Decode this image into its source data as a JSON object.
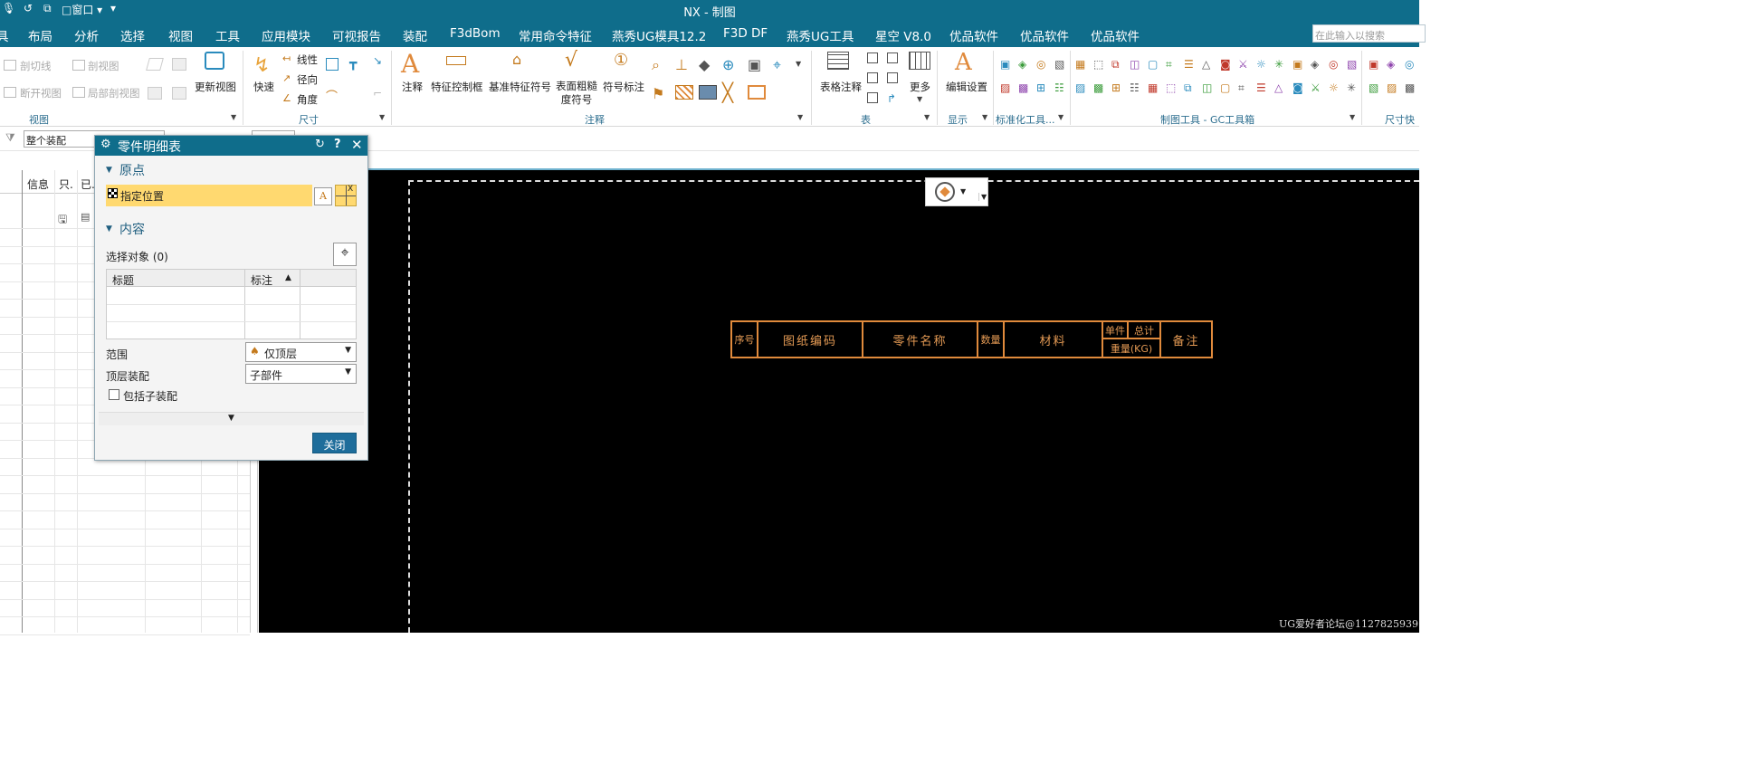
{
  "window": {
    "title": "NX - 制图",
    "window_menu": "窗口"
  },
  "menu": [
    "具",
    "布局",
    "分析",
    "选择",
    "视图",
    "工具",
    "应用模块",
    "可视报告",
    "装配",
    "F3dBom",
    "常用命令特征",
    "燕秀UG模具12.2",
    "F3D DF",
    "燕秀UG工具",
    "星空 V8.0",
    "优品软件",
    "优品软件",
    "优品软件"
  ],
  "search": {
    "placeholder": "在此输入以搜索"
  },
  "ribbon": {
    "view_group": {
      "label": "视图",
      "items": [
        "剖切线",
        "剖视图",
        "断开视图",
        "局部剖视图",
        "更新视图"
      ]
    },
    "dim_group": {
      "label": "尺寸",
      "items": [
        "快速",
        "线性",
        "径向",
        "角度"
      ]
    },
    "annotation_group": {
      "label": "注释",
      "items": [
        "注释",
        "特征控制框",
        "基准特征符号",
        "表面粗糙度符号",
        "符号标注"
      ]
    },
    "table_group": {
      "label": "表",
      "items": [
        "表格注释",
        "更多"
      ]
    },
    "display_group": {
      "label": "显示",
      "items": [
        "编辑设置"
      ]
    },
    "std_group": {
      "label": "标准化工具..."
    },
    "gc_group": {
      "label": "制图工具 - GC工具箱"
    },
    "size_group": {
      "label": "尺寸快"
    }
  },
  "selection_filter": {
    "value": "整个装配"
  },
  "left_nav": {
    "headers": [
      "信息",
      "只.",
      "已."
    ]
  },
  "dialog": {
    "title": "零件明细表",
    "origin_section": "原点",
    "specify_location": "指定位置",
    "content_section": "内容",
    "select_objects": "选择对象 (0)",
    "table_headers": [
      "标题",
      "标注"
    ],
    "scope_label": "范围",
    "scope_value": "仅顶层",
    "top_assembly_label": "顶层装配",
    "top_assembly_value": "子部件",
    "include_subassembly": "包括子装配",
    "include_subassembly_checked": false,
    "close_button": "关闭"
  },
  "bom_header": {
    "seq": "序号",
    "drawing_no": "图纸编码",
    "part_name": "零件名称",
    "qty": "数量",
    "material": "材料",
    "unit": "单件",
    "total": "总计",
    "weight": "重量(KG)",
    "remark": "备注"
  },
  "watermark": "UG爱好者论坛@1127825939",
  "colors": {
    "title_bar": "#0f6d8b",
    "highlight": "#ffd970",
    "bom_line": "#e08a3c",
    "accent_button": "#1e6d9b"
  }
}
